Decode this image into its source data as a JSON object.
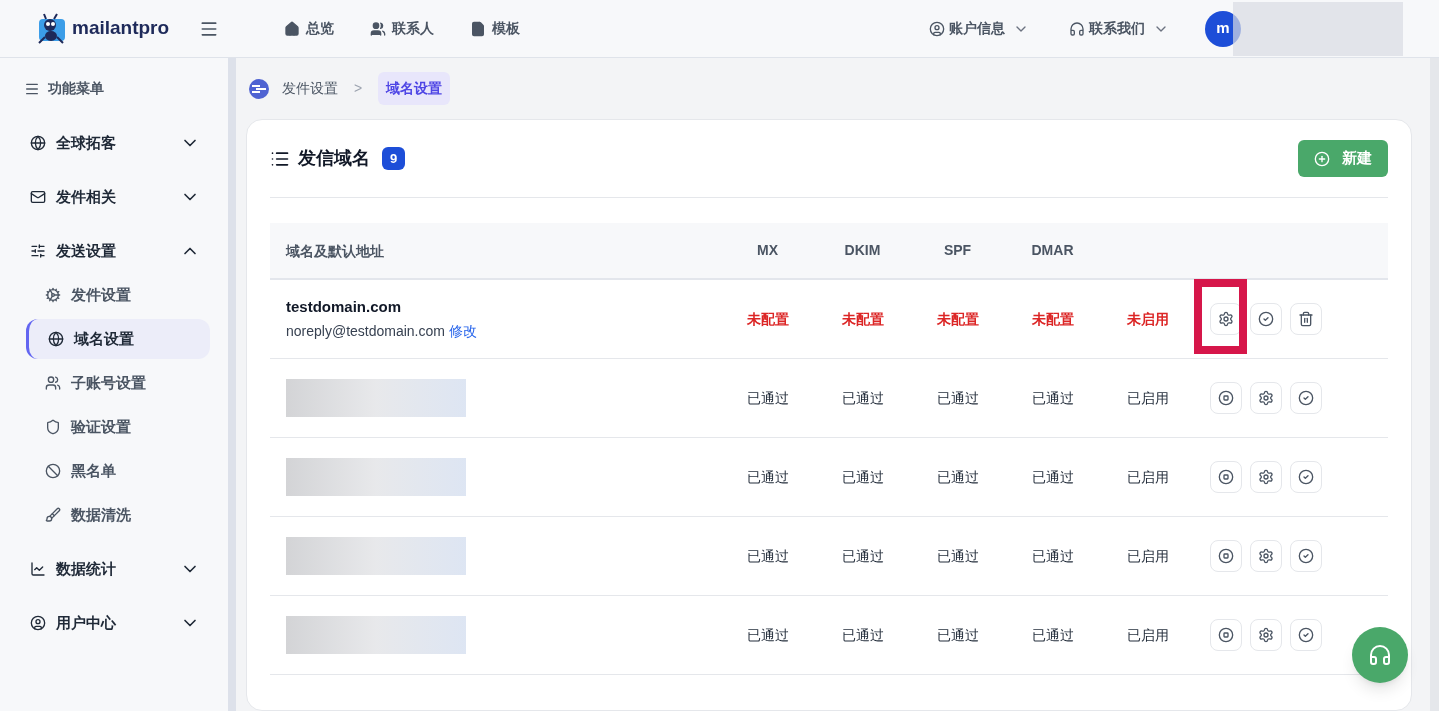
{
  "header": {
    "logo": "mailantpro",
    "nav": [
      {
        "kind": "home",
        "label": "总览"
      },
      {
        "kind": "users",
        "label": "联系人"
      },
      {
        "kind": "file",
        "label": "模板"
      }
    ],
    "menus": [
      {
        "kind": "account",
        "label": "账户信息"
      },
      {
        "kind": "support",
        "label": "联系我们"
      }
    ],
    "avatar": "m"
  },
  "sidebar": {
    "title": "功能菜单",
    "groups": [
      {
        "kind": "globe",
        "label": "全球拓客",
        "expanded": false
      },
      {
        "kind": "mail",
        "label": "发件相关",
        "expanded": false
      },
      {
        "kind": "sliders",
        "label": "发送设置",
        "expanded": true,
        "children": [
          {
            "kind": "gears",
            "label": "发件设置",
            "selected": false
          },
          {
            "kind": "globe",
            "label": "域名设置",
            "selected": true
          },
          {
            "kind": "users",
            "label": "子账号设置",
            "selected": false
          },
          {
            "kind": "shield",
            "label": "验证设置",
            "selected": false
          },
          {
            "kind": "ban",
            "label": "黑名单",
            "selected": false
          },
          {
            "kind": "brush",
            "label": "数据清洗",
            "selected": false
          }
        ]
      },
      {
        "kind": "chart",
        "label": "数据统计",
        "expanded": false
      },
      {
        "kind": "user",
        "label": "用户中心",
        "expanded": false
      }
    ]
  },
  "breadcrumb_separator": ">",
  "breadcrumb": [
    {
      "label": "发件设置",
      "selected": false
    },
    {
      "label": "域名设置",
      "selected": true
    }
  ],
  "panel": {
    "title": "发信域名",
    "count": "9",
    "new_button": "新建",
    "table": {
      "columns": [
        "域名及默认地址",
        "MX",
        "DKIM",
        "SPF",
        "DMAR"
      ],
      "rows": [
        {
          "domain": "testdomain.com",
          "address": "noreply@testdomain.com",
          "edit_link": "修改",
          "redacted": false,
          "statuses": [
            {
              "text": "未配置",
              "ok": false
            },
            {
              "text": "未配置",
              "ok": false
            },
            {
              "text": "未配置",
              "ok": false
            },
            {
              "text": "未配置",
              "ok": false
            },
            {
              "text": "未启用",
              "ok": false
            }
          ],
          "actions": [
            {
              "kind": "settings",
              "highlighted": true
            },
            {
              "kind": "verify",
              "highlighted": false
            },
            {
              "kind": "delete",
              "highlighted": false
            }
          ]
        },
        {
          "redacted": true,
          "statuses": [
            {
              "text": "已通过",
              "ok": true
            },
            {
              "text": "已通过",
              "ok": true
            },
            {
              "text": "已通过",
              "ok": true
            },
            {
              "text": "已通过",
              "ok": true
            },
            {
              "text": "已启用",
              "ok": true
            }
          ],
          "actions": [
            {
              "kind": "stop",
              "highlighted": false
            },
            {
              "kind": "settings",
              "highlighted": false
            },
            {
              "kind": "verify",
              "highlighted": false
            }
          ]
        },
        {
          "redacted": true,
          "statuses": [
            {
              "text": "已通过",
              "ok": true
            },
            {
              "text": "已通过",
              "ok": true
            },
            {
              "text": "已通过",
              "ok": true
            },
            {
              "text": "已通过",
              "ok": true
            },
            {
              "text": "已启用",
              "ok": true
            }
          ],
          "actions": [
            {
              "kind": "stop",
              "highlighted": false
            },
            {
              "kind": "settings",
              "highlighted": false
            },
            {
              "kind": "verify",
              "highlighted": false
            }
          ]
        },
        {
          "redacted": true,
          "statuses": [
            {
              "text": "已通过",
              "ok": true
            },
            {
              "text": "已通过",
              "ok": true
            },
            {
              "text": "已通过",
              "ok": true
            },
            {
              "text": "已通过",
              "ok": true
            },
            {
              "text": "已启用",
              "ok": true
            }
          ],
          "actions": [
            {
              "kind": "stop",
              "highlighted": false
            },
            {
              "kind": "settings",
              "highlighted": false
            },
            {
              "kind": "verify",
              "highlighted": false
            }
          ]
        },
        {
          "redacted": true,
          "statuses": [
            {
              "text": "已通过",
              "ok": true
            },
            {
              "text": "已通过",
              "ok": true
            },
            {
              "text": "已通过",
              "ok": true
            },
            {
              "text": "已通过",
              "ok": true
            },
            {
              "text": "已启用",
              "ok": true
            }
          ],
          "actions": [
            {
              "kind": "stop",
              "highlighted": false
            },
            {
              "kind": "settings",
              "highlighted": false
            },
            {
              "kind": "verify",
              "highlighted": false
            }
          ]
        }
      ]
    }
  }
}
